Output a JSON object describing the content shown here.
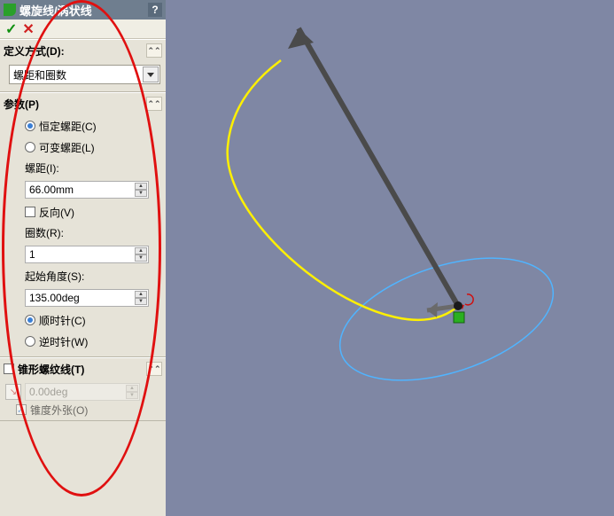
{
  "titlebar": {
    "feature_name": "螺旋线/涡状线",
    "help_label": "?"
  },
  "actions": {
    "ok_label": "✓",
    "cancel_label": "✕"
  },
  "section_def": {
    "header": "定义方式(D):",
    "dropdown_value": "螺距和圈数"
  },
  "section_params": {
    "header": "参数(P)",
    "radio_constant": "恒定螺距(C)",
    "radio_variable": "可变螺距(L)",
    "pitch_label": "螺距(I):",
    "pitch_value": "66.00mm",
    "reverse_label": "反向(V)",
    "revolutions_label": "圈数(R):",
    "revolutions_value": "1",
    "start_angle_label": "起始角度(S):",
    "start_angle_value": "135.00deg",
    "radio_cw": "顺时针(C)",
    "radio_ccw": "逆时针(W)"
  },
  "section_taper": {
    "header": "锥形螺纹线(T)",
    "angle_value": "0.00deg",
    "taper_outward": "锥度外张(O)"
  }
}
